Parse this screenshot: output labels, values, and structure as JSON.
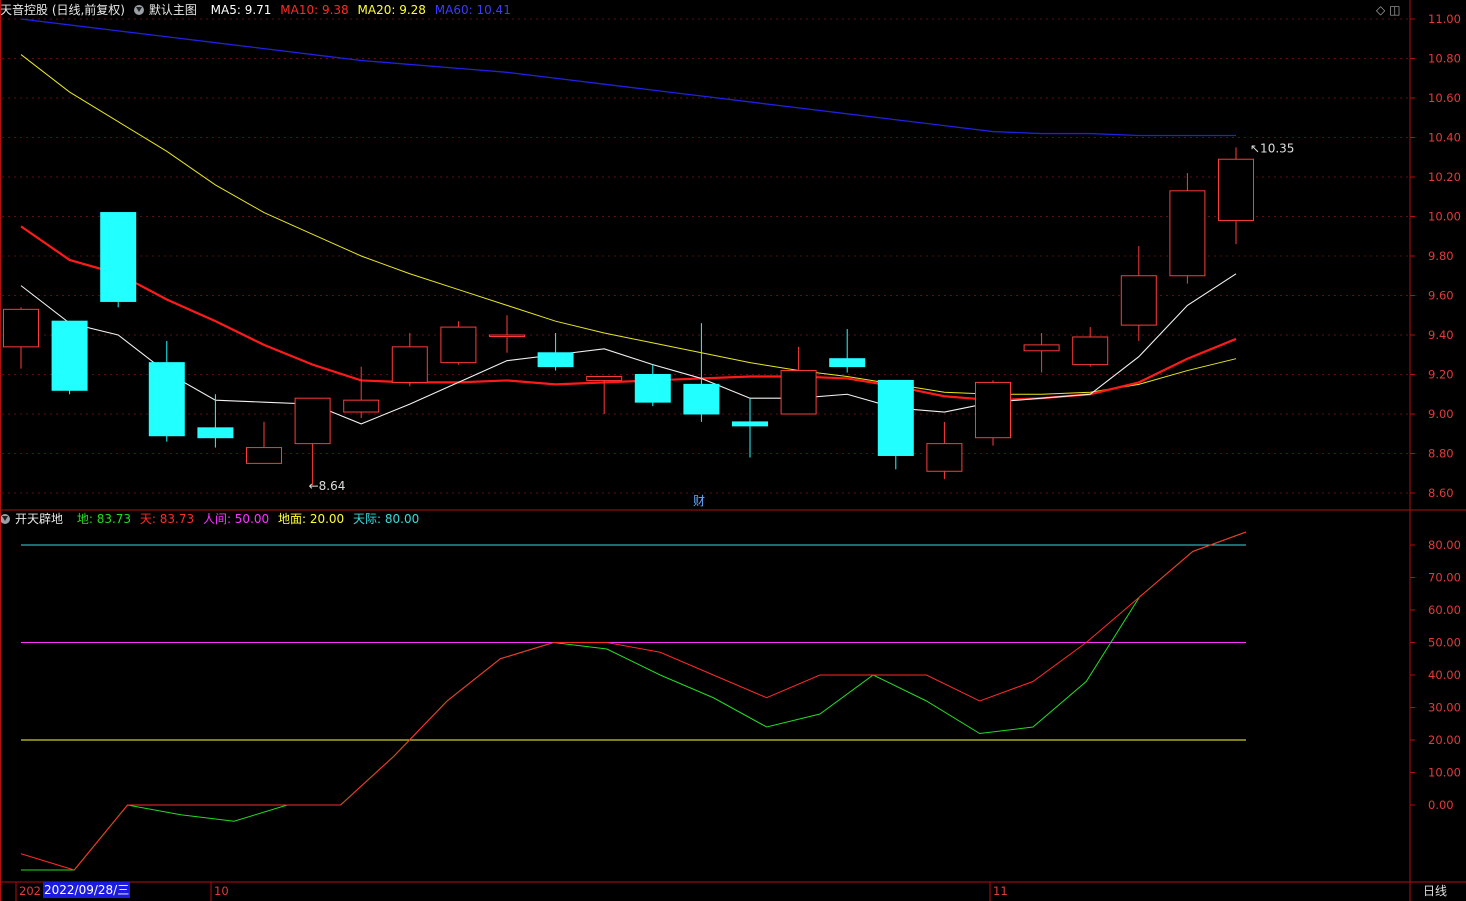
{
  "main_chart": {
    "title": "天音控股 (日线,前复权)",
    "main_label": "默认主图",
    "legend": [
      {
        "label": "MA5: 9.71",
        "color": "#ffffff"
      },
      {
        "label": "MA10: 9.38",
        "color": "#ff2a2a"
      },
      {
        "label": "MA20: 9.28",
        "color": "#ffff33"
      },
      {
        "label": "MA60: 10.41",
        "color": "#3b3bff"
      }
    ],
    "high_mark": "10.35",
    "low_mark": "8.64",
    "event_mark": "财"
  },
  "indicator_chart": {
    "title": "开天辟地",
    "legend": [
      {
        "label": "地: 83.73",
        "color": "#22dd22"
      },
      {
        "label": "天: 83.73",
        "color": "#ff2a2a"
      },
      {
        "label": "人间: 50.00",
        "color": "#ff33ff"
      },
      {
        "label": "地面: 20.00",
        "color": "#ffff33"
      },
      {
        "label": "天际: 80.00",
        "color": "#33dddd"
      }
    ]
  },
  "axis": {
    "price_ticks": [
      "11.00",
      "10.80",
      "10.60",
      "10.40",
      "10.20",
      "10.00",
      "9.80",
      "9.60",
      "9.40",
      "9.20",
      "9.00",
      "8.80",
      "8.60"
    ],
    "indicator_ticks": [
      "80.00",
      "70.00",
      "60.00",
      "50.00",
      "40.00",
      "30.00",
      "20.00",
      "10.00",
      "0.00"
    ],
    "x_labels": [
      "202",
      "10",
      "11"
    ],
    "date_cursor": "2022/09/28/三",
    "period": "日线"
  },
  "chart_data": {
    "type": "candlestick",
    "price_range": [
      8.55,
      11.05
    ],
    "indicator_range": [
      -22,
      89
    ],
    "candles": [
      {
        "o": 9.34,
        "h": 9.54,
        "l": 9.23,
        "c": 9.53
      },
      {
        "o": 9.47,
        "h": 9.47,
        "l": 9.1,
        "c": 9.12
      },
      {
        "o": 10.02,
        "h": 10.02,
        "l": 9.54,
        "c": 9.57
      },
      {
        "o": 9.26,
        "h": 9.37,
        "l": 8.86,
        "c": 8.89
      },
      {
        "o": 8.93,
        "h": 9.1,
        "l": 8.83,
        "c": 8.88
      },
      {
        "o": 8.75,
        "h": 8.96,
        "l": 8.75,
        "c": 8.83
      },
      {
        "o": 8.85,
        "h": 9.08,
        "l": 8.64,
        "c": 9.08
      },
      {
        "o": 9.01,
        "h": 9.24,
        "l": 8.98,
        "c": 9.07
      },
      {
        "o": 9.16,
        "h": 9.41,
        "l": 9.14,
        "c": 9.34
      },
      {
        "o": 9.26,
        "h": 9.47,
        "l": 9.25,
        "c": 9.44
      },
      {
        "o": 9.4,
        "h": 9.5,
        "l": 9.31,
        "c": 9.4
      },
      {
        "o": 9.31,
        "h": 9.41,
        "l": 9.22,
        "c": 9.24
      },
      {
        "o": 9.17,
        "h": 9.19,
        "l": 9.0,
        "c": 9.19
      },
      {
        "o": 9.2,
        "h": 9.25,
        "l": 9.04,
        "c": 9.06
      },
      {
        "o": 9.15,
        "h": 9.46,
        "l": 8.96,
        "c": 9.0
      },
      {
        "o": 8.96,
        "h": 9.08,
        "l": 8.78,
        "c": 8.94
      },
      {
        "o": 9.0,
        "h": 9.34,
        "l": 9.0,
        "c": 9.22
      },
      {
        "o": 9.28,
        "h": 9.43,
        "l": 9.21,
        "c": 9.24
      },
      {
        "o": 9.17,
        "h": 9.17,
        "l": 8.72,
        "c": 8.79
      },
      {
        "o": 8.71,
        "h": 8.96,
        "l": 8.67,
        "c": 8.85
      },
      {
        "o": 8.88,
        "h": 9.17,
        "l": 8.84,
        "c": 9.16
      },
      {
        "o": 9.32,
        "h": 9.41,
        "l": 9.21,
        "c": 9.35
      },
      {
        "o": 9.25,
        "h": 9.44,
        "l": 9.24,
        "c": 9.39
      },
      {
        "o": 9.45,
        "h": 9.85,
        "l": 9.37,
        "c": 9.7
      },
      {
        "o": 9.7,
        "h": 10.22,
        "l": 9.66,
        "c": 10.13
      },
      {
        "o": 9.98,
        "h": 10.35,
        "l": 9.86,
        "c": 10.29
      }
    ],
    "ma5": [
      9.65,
      9.46,
      9.4,
      9.21,
      9.07,
      9.06,
      9.05,
      8.95,
      9.05,
      9.16,
      9.27,
      9.3,
      9.33,
      9.25,
      9.18,
      9.08,
      9.08,
      9.1,
      9.03,
      9.01,
      9.06,
      9.08,
      9.1,
      9.29,
      9.55,
      9.71
    ],
    "ma10": [
      9.95,
      9.78,
      9.71,
      9.58,
      9.47,
      9.35,
      9.25,
      9.17,
      9.16,
      9.16,
      9.17,
      9.15,
      9.16,
      9.17,
      9.18,
      9.19,
      9.19,
      9.18,
      9.14,
      9.09,
      9.07,
      9.08,
      9.1,
      9.16,
      9.28,
      9.38
    ],
    "ma20": [
      10.82,
      10.63,
      10.48,
      10.33,
      10.16,
      10.02,
      9.91,
      9.8,
      9.71,
      9.63,
      9.55,
      9.47,
      9.41,
      9.36,
      9.31,
      9.26,
      9.22,
      9.19,
      9.15,
      9.11,
      9.1,
      9.1,
      9.11,
      9.15,
      9.22,
      9.28
    ],
    "ma60": [
      11.0,
      10.97,
      10.94,
      10.91,
      10.88,
      10.85,
      10.82,
      10.79,
      10.77,
      10.75,
      10.73,
      10.7,
      10.67,
      10.64,
      10.61,
      10.58,
      10.55,
      10.52,
      10.49,
      10.46,
      10.43,
      10.42,
      10.42,
      10.41,
      10.41,
      10.41
    ],
    "tian": [
      -15,
      -20,
      0,
      0,
      0,
      0,
      0,
      15,
      32,
      45,
      50,
      50,
      47,
      40,
      33,
      40,
      40,
      40,
      32,
      38,
      50,
      64,
      78,
      84
    ],
    "di": [
      -20,
      -20,
      0,
      -3,
      -5,
      0,
      0,
      15,
      32,
      45,
      50,
      48,
      40,
      33,
      24,
      28,
      40,
      32,
      22,
      24,
      38,
      64,
      78,
      84
    ],
    "levels": {
      "tianji": 80,
      "renjian": 50,
      "dimian": 20
    }
  }
}
